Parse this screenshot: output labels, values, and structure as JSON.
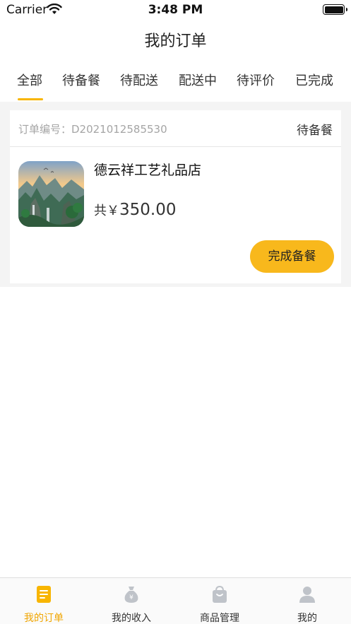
{
  "status_bar": {
    "carrier": "Carrier",
    "time": "3:48 PM"
  },
  "nav": {
    "title": "我的订单"
  },
  "tabs": [
    {
      "label": "全部",
      "active": true
    },
    {
      "label": "待备餐"
    },
    {
      "label": "待配送"
    },
    {
      "label": "配送中"
    },
    {
      "label": "待评价"
    },
    {
      "label": "已完成"
    }
  ],
  "order": {
    "number_label": "订单编号：D2021012585530",
    "status": "待备餐",
    "shop_name": "德云祥工艺礼品店",
    "price_prefix": "共￥",
    "price_value": "350.00",
    "action_label": "完成备餐"
  },
  "bottom_nav": [
    {
      "label": "我的订单",
      "icon": "order-icon",
      "active": true
    },
    {
      "label": "我的收入",
      "icon": "money-bag-icon"
    },
    {
      "label": "商品管理",
      "icon": "shopping-bag-icon"
    },
    {
      "label": "我的",
      "icon": "user-icon"
    }
  ],
  "colors": {
    "accent": "#f8b500",
    "button": "#f8b81c",
    "inactive_icon": "#bfc3c9"
  }
}
